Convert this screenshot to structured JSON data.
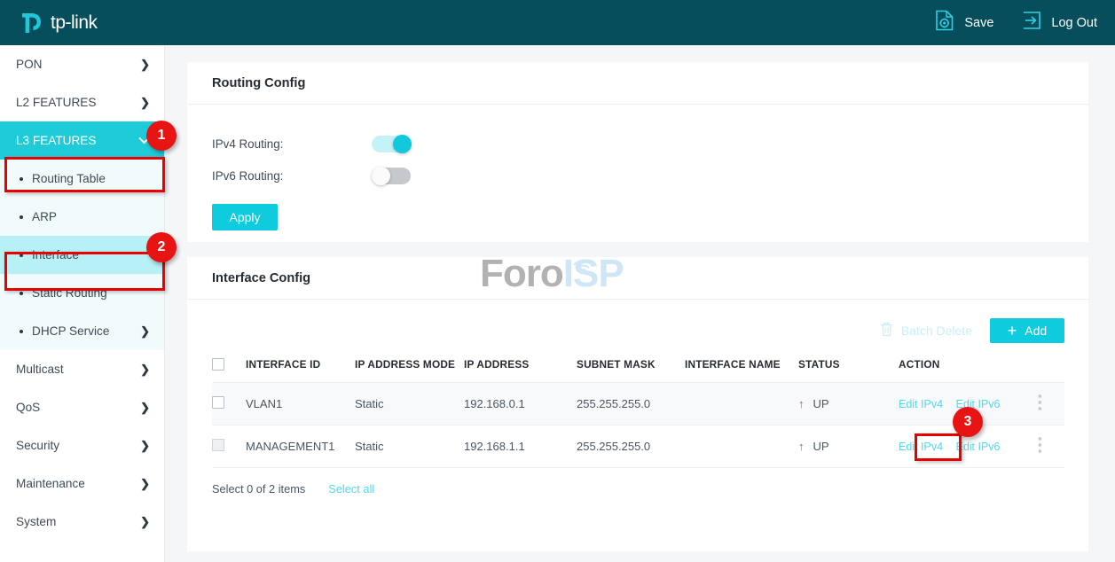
{
  "topbar": {
    "brand": "tp-link",
    "logo_icon": "tplink-logo-icon",
    "save_label": "Save",
    "save_icon": "save-gear-document-icon",
    "logout_label": "Log Out",
    "logout_icon": "logout-arrow-icon"
  },
  "sidebar": {
    "top_items": [
      {
        "label": "PON",
        "chevron": "❯",
        "state": "collapsed"
      },
      {
        "label": "L2 FEATURES",
        "chevron": "❯",
        "state": "collapsed"
      },
      {
        "label": "L3 FEATURES",
        "chevron": "❯",
        "state": "expanded"
      }
    ],
    "sub_items": [
      {
        "label": "Routing Table",
        "chevron": ""
      },
      {
        "label": "ARP",
        "chevron": ""
      },
      {
        "label": "Interface",
        "chevron": ""
      },
      {
        "label": "Static Routing",
        "chevron": ""
      },
      {
        "label": "DHCP Service",
        "chevron": "❯"
      }
    ],
    "bottom_items": [
      {
        "label": "Multicast",
        "chevron": "❯"
      },
      {
        "label": "QoS",
        "chevron": "❯"
      },
      {
        "label": "Security",
        "chevron": "❯"
      },
      {
        "label": "Maintenance",
        "chevron": "❯"
      },
      {
        "label": "System",
        "chevron": "❯"
      }
    ]
  },
  "annotations": {
    "badge1": "1",
    "badge2": "2",
    "badge3": "3",
    "color": "#e81414"
  },
  "routing_config": {
    "title": "Routing Config",
    "ipv4_label": "IPv4 Routing:",
    "ipv4_state": "on",
    "ipv6_label": "IPv6 Routing:",
    "ipv6_state": "off",
    "apply_label": "Apply"
  },
  "interface_config": {
    "title": "Interface Config",
    "batch_delete_label": "Batch Delete",
    "batch_delete_icon": "trash-icon",
    "add_label": "Add",
    "add_icon": "plus-icon",
    "columns": [
      "INTERFACE ID",
      "IP ADDRESS MODE",
      "IP ADDRESS",
      "SUBNET MASK",
      "INTERFACE NAME",
      "STATUS",
      "ACTION"
    ],
    "rows": [
      {
        "checkbox": "unchecked",
        "interface_id": "VLAN1",
        "mode": "Static",
        "ip_address": "192.168.0.1",
        "subnet_mask": "255.255.255.0",
        "interface_name": "",
        "status": "UP",
        "status_icon": "up-arrow-icon",
        "edit_ipv4": "Edit IPv4",
        "edit_ipv6": "Edit IPv6",
        "menu_icon": "kebab-menu-icon"
      },
      {
        "checkbox": "disabled",
        "interface_id": "MANAGEMENT1",
        "mode": "Static",
        "ip_address": "192.168.1.1",
        "subnet_mask": "255.255.255.0",
        "interface_name": "",
        "status": "UP",
        "status_icon": "up-arrow-icon",
        "edit_ipv4": "Edit IPv4",
        "edit_ipv6": "Edit IPv6",
        "menu_icon": "kebab-menu-icon"
      }
    ],
    "footer_count": "Select 0 of 2 items",
    "select_all_label": "Select all"
  },
  "watermark": {
    "part1": "Foro",
    "part2": "ISP",
    "icon": "wifi-signal-icon"
  },
  "colors": {
    "header_bg": "#064e5c",
    "accent": "#0ecbde",
    "active_nav": "#1ecbd8",
    "sub_selected": "#b7f0f5",
    "status_arrow": "#cc34cc",
    "link": "#56d7ef"
  }
}
